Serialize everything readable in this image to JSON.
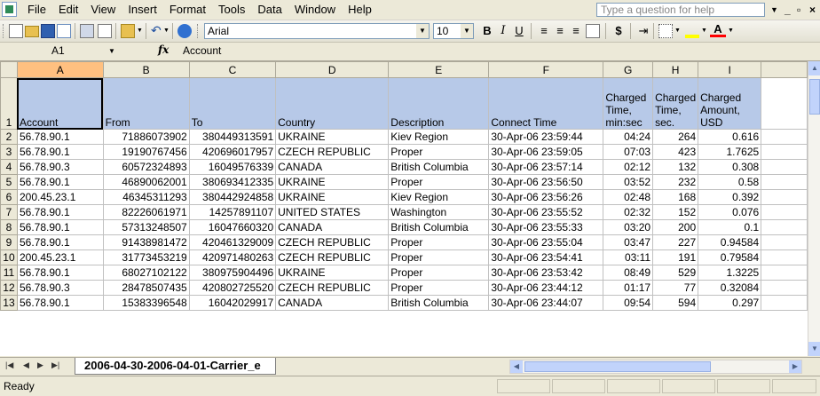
{
  "menu": {
    "items": [
      "File",
      "Edit",
      "View",
      "Insert",
      "Format",
      "Tools",
      "Data",
      "Window",
      "Help"
    ],
    "help_placeholder": "Type a question for help"
  },
  "toolbar": {
    "font_name": "Arial",
    "font_size": "10",
    "bold": "B",
    "italic": "I",
    "underline": "U",
    "currency": "$"
  },
  "formula_bar": {
    "cell_ref": "A1",
    "fx": "fx",
    "content": "Account"
  },
  "sheet": {
    "columns": [
      "A",
      "B",
      "C",
      "D",
      "E",
      "F",
      "G",
      "H",
      "I"
    ],
    "header_row": {
      "num": "1",
      "cells": [
        "Account",
        "From",
        "To",
        "Country",
        "Description",
        "Connect Time",
        "Charged Time, min:sec",
        "Charged Time, sec.",
        "Charged Amount, USD"
      ]
    },
    "rows": [
      {
        "num": "2",
        "cells": [
          "56.78.90.1",
          "71886073902",
          "380449313591",
          "UKRAINE",
          "Kiev Region",
          "30-Apr-06 23:59:44",
          "04:24",
          "264",
          "0.616"
        ]
      },
      {
        "num": "3",
        "cells": [
          "56.78.90.1",
          "19190767456",
          "420696017957",
          "CZECH REPUBLIC",
          "Proper",
          "30-Apr-06 23:59:05",
          "07:03",
          "423",
          "1.7625"
        ]
      },
      {
        "num": "4",
        "cells": [
          "56.78.90.3",
          "60572324893",
          "16049576339",
          "CANADA",
          "British Columbia",
          "30-Apr-06 23:57:14",
          "02:12",
          "132",
          "0.308"
        ]
      },
      {
        "num": "5",
        "cells": [
          "56.78.90.1",
          "46890062001",
          "380693412335",
          "UKRAINE",
          "Proper",
          "30-Apr-06 23:56:50",
          "03:52",
          "232",
          "0.58"
        ]
      },
      {
        "num": "6",
        "cells": [
          "200.45.23.1",
          "46345311293",
          "380442924858",
          "UKRAINE",
          "Kiev Region",
          "30-Apr-06 23:56:26",
          "02:48",
          "168",
          "0.392"
        ]
      },
      {
        "num": "7",
        "cells": [
          "56.78.90.1",
          "82226061971",
          "14257891107",
          "UNITED STATES",
          "Washington",
          "30-Apr-06 23:55:52",
          "02:32",
          "152",
          "0.076"
        ]
      },
      {
        "num": "8",
        "cells": [
          "56.78.90.1",
          "57313248507",
          "16047660320",
          "CANADA",
          "British Columbia",
          "30-Apr-06 23:55:33",
          "03:20",
          "200",
          "0.1"
        ]
      },
      {
        "num": "9",
        "cells": [
          "56.78.90.1",
          "91438981472",
          "420461329009",
          "CZECH REPUBLIC",
          "Proper",
          "30-Apr-06 23:55:04",
          "03:47",
          "227",
          "0.94584"
        ]
      },
      {
        "num": "10",
        "cells": [
          "200.45.23.1",
          "31773453219",
          "420971480263",
          "CZECH REPUBLIC",
          "Proper",
          "30-Apr-06 23:54:41",
          "03:11",
          "191",
          "0.79584"
        ]
      },
      {
        "num": "11",
        "cells": [
          "56.78.90.1",
          "68027102122",
          "380975904496",
          "UKRAINE",
          "Proper",
          "30-Apr-06 23:53:42",
          "08:49",
          "529",
          "1.3225"
        ]
      },
      {
        "num": "12",
        "cells": [
          "56.78.90.3",
          "28478507435",
          "420802725520",
          "CZECH REPUBLIC",
          "Proper",
          "30-Apr-06 23:44:12",
          "01:17",
          "77",
          "0.32084"
        ]
      },
      {
        "num": "13",
        "cells": [
          "56.78.90.1",
          "15383396548",
          "16042029917",
          "CANADA",
          "British Columbia",
          "30-Apr-06 23:44:07",
          "09:54",
          "594",
          "0.297"
        ]
      }
    ]
  },
  "tabs": {
    "active": "2006-04-30-2006-04-01-Carrier_e"
  },
  "status": {
    "text": "Ready"
  }
}
